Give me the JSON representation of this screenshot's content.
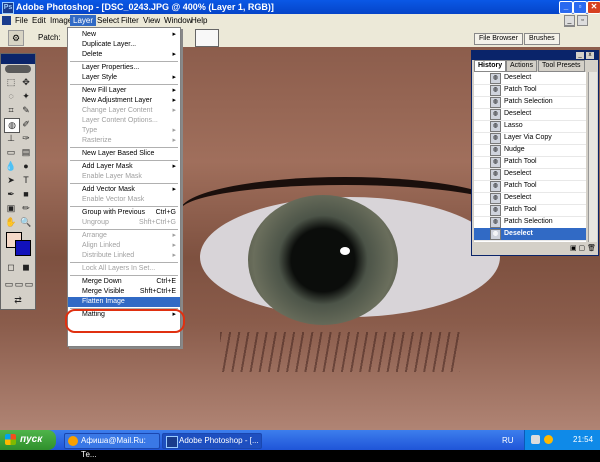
{
  "window": {
    "title": "Adobe Photoshop - [DSC_0243.JPG @ 400% (Layer 1, RGB)]",
    "app_icon": "Ps"
  },
  "menubar": {
    "items": [
      "File",
      "Edit",
      "Image",
      "Layer",
      "Select",
      "Filter",
      "View",
      "Window",
      "Help"
    ],
    "active": "Layer"
  },
  "options_bar": {
    "patch_label": "Patch:"
  },
  "layer_menu": {
    "items": [
      {
        "label": "New",
        "submenu": true
      },
      {
        "label": "Duplicate Layer..."
      },
      {
        "label": "Delete",
        "submenu": true
      },
      {
        "sep": true
      },
      {
        "label": "Layer Properties..."
      },
      {
        "label": "Layer Style",
        "submenu": true
      },
      {
        "sep": true
      },
      {
        "label": "New Fill Layer",
        "submenu": true
      },
      {
        "label": "New Adjustment Layer",
        "submenu": true
      },
      {
        "label": "Change Layer Content",
        "submenu": true,
        "disabled": true
      },
      {
        "label": "Layer Content Options...",
        "disabled": true
      },
      {
        "label": "Type",
        "submenu": true,
        "disabled": true
      },
      {
        "label": "Rasterize",
        "submenu": true,
        "disabled": true
      },
      {
        "sep": true
      },
      {
        "label": "New Layer Based Slice"
      },
      {
        "sep": true
      },
      {
        "label": "Add Layer Mask",
        "submenu": true
      },
      {
        "label": "Enable Layer Mask",
        "disabled": true
      },
      {
        "sep": true
      },
      {
        "label": "Add Vector Mask",
        "submenu": true
      },
      {
        "label": "Enable Vector Mask",
        "disabled": true
      },
      {
        "sep": true
      },
      {
        "label": "Group with Previous",
        "shortcut": "Ctrl+G"
      },
      {
        "label": "Ungroup",
        "shortcut": "Shft+Ctrl+G",
        "disabled": true
      },
      {
        "sep": true
      },
      {
        "label": "Arrange",
        "submenu": true,
        "disabled": true
      },
      {
        "label": "Align Linked",
        "submenu": true,
        "disabled": true
      },
      {
        "label": "Distribute Linked",
        "submenu": true,
        "disabled": true
      },
      {
        "sep": true
      },
      {
        "label": "Lock All Layers In Set...",
        "disabled": true
      },
      {
        "sep": true
      },
      {
        "label": "Merge Down",
        "shortcut": "Ctrl+E"
      },
      {
        "label": "Merge Visible",
        "shortcut": "Shft+Ctrl+E"
      },
      {
        "label": "Flatten Image",
        "highlighted": true
      },
      {
        "sep": true
      },
      {
        "label": "Matting",
        "submenu": true
      }
    ]
  },
  "palette_well": {
    "tabs": [
      "File Browser",
      "Brushes"
    ]
  },
  "history_palette": {
    "tabs": [
      "History",
      "Actions",
      "Tool Presets"
    ],
    "active_tab": "History",
    "rows": [
      {
        "label": "Deselect"
      },
      {
        "label": "Patch Tool"
      },
      {
        "label": "Patch Selection"
      },
      {
        "label": "Deselect"
      },
      {
        "label": "Lasso"
      },
      {
        "label": "Layer Via Copy"
      },
      {
        "label": "Nudge"
      },
      {
        "label": "Patch Tool"
      },
      {
        "label": "Deselect"
      },
      {
        "label": "Patch Tool"
      },
      {
        "label": "Deselect"
      },
      {
        "label": "Patch Tool"
      },
      {
        "label": "Patch Selection"
      },
      {
        "label": "Deselect",
        "selected": true
      }
    ]
  },
  "taskbar": {
    "start_label": "пуск",
    "items": [
      {
        "label": "Афиша@Mail.Ru: Те..."
      },
      {
        "label": "Adobe Photoshop - [...",
        "active": true
      }
    ],
    "lang": "RU",
    "clock": "21:54"
  }
}
